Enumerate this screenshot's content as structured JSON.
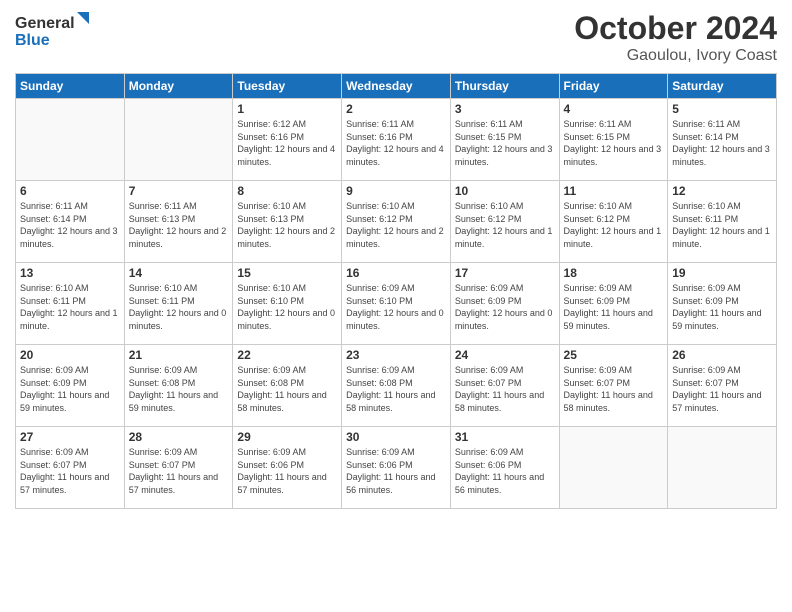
{
  "header": {
    "logo_general": "General",
    "logo_blue": "Blue",
    "month_title": "October 2024",
    "location": "Gaoulou, Ivory Coast"
  },
  "weekdays": [
    "Sunday",
    "Monday",
    "Tuesday",
    "Wednesday",
    "Thursday",
    "Friday",
    "Saturday"
  ],
  "weeks": [
    [
      {
        "day": "",
        "info": ""
      },
      {
        "day": "",
        "info": ""
      },
      {
        "day": "1",
        "info": "Sunrise: 6:12 AM\nSunset: 6:16 PM\nDaylight: 12 hours\nand 4 minutes."
      },
      {
        "day": "2",
        "info": "Sunrise: 6:11 AM\nSunset: 6:16 PM\nDaylight: 12 hours\nand 4 minutes."
      },
      {
        "day": "3",
        "info": "Sunrise: 6:11 AM\nSunset: 6:15 PM\nDaylight: 12 hours\nand 3 minutes."
      },
      {
        "day": "4",
        "info": "Sunrise: 6:11 AM\nSunset: 6:15 PM\nDaylight: 12 hours\nand 3 minutes."
      },
      {
        "day": "5",
        "info": "Sunrise: 6:11 AM\nSunset: 6:14 PM\nDaylight: 12 hours\nand 3 minutes."
      }
    ],
    [
      {
        "day": "6",
        "info": "Sunrise: 6:11 AM\nSunset: 6:14 PM\nDaylight: 12 hours\nand 3 minutes."
      },
      {
        "day": "7",
        "info": "Sunrise: 6:11 AM\nSunset: 6:13 PM\nDaylight: 12 hours\nand 2 minutes."
      },
      {
        "day": "8",
        "info": "Sunrise: 6:10 AM\nSunset: 6:13 PM\nDaylight: 12 hours\nand 2 minutes."
      },
      {
        "day": "9",
        "info": "Sunrise: 6:10 AM\nSunset: 6:12 PM\nDaylight: 12 hours\nand 2 minutes."
      },
      {
        "day": "10",
        "info": "Sunrise: 6:10 AM\nSunset: 6:12 PM\nDaylight: 12 hours\nand 1 minute."
      },
      {
        "day": "11",
        "info": "Sunrise: 6:10 AM\nSunset: 6:12 PM\nDaylight: 12 hours\nand 1 minute."
      },
      {
        "day": "12",
        "info": "Sunrise: 6:10 AM\nSunset: 6:11 PM\nDaylight: 12 hours\nand 1 minute."
      }
    ],
    [
      {
        "day": "13",
        "info": "Sunrise: 6:10 AM\nSunset: 6:11 PM\nDaylight: 12 hours\nand 1 minute."
      },
      {
        "day": "14",
        "info": "Sunrise: 6:10 AM\nSunset: 6:11 PM\nDaylight: 12 hours\nand 0 minutes."
      },
      {
        "day": "15",
        "info": "Sunrise: 6:10 AM\nSunset: 6:10 PM\nDaylight: 12 hours\nand 0 minutes."
      },
      {
        "day": "16",
        "info": "Sunrise: 6:09 AM\nSunset: 6:10 PM\nDaylight: 12 hours\nand 0 minutes."
      },
      {
        "day": "17",
        "info": "Sunrise: 6:09 AM\nSunset: 6:09 PM\nDaylight: 12 hours\nand 0 minutes."
      },
      {
        "day": "18",
        "info": "Sunrise: 6:09 AM\nSunset: 6:09 PM\nDaylight: 11 hours\nand 59 minutes."
      },
      {
        "day": "19",
        "info": "Sunrise: 6:09 AM\nSunset: 6:09 PM\nDaylight: 11 hours\nand 59 minutes."
      }
    ],
    [
      {
        "day": "20",
        "info": "Sunrise: 6:09 AM\nSunset: 6:09 PM\nDaylight: 11 hours\nand 59 minutes."
      },
      {
        "day": "21",
        "info": "Sunrise: 6:09 AM\nSunset: 6:08 PM\nDaylight: 11 hours\nand 59 minutes."
      },
      {
        "day": "22",
        "info": "Sunrise: 6:09 AM\nSunset: 6:08 PM\nDaylight: 11 hours\nand 58 minutes."
      },
      {
        "day": "23",
        "info": "Sunrise: 6:09 AM\nSunset: 6:08 PM\nDaylight: 11 hours\nand 58 minutes."
      },
      {
        "day": "24",
        "info": "Sunrise: 6:09 AM\nSunset: 6:07 PM\nDaylight: 11 hours\nand 58 minutes."
      },
      {
        "day": "25",
        "info": "Sunrise: 6:09 AM\nSunset: 6:07 PM\nDaylight: 11 hours\nand 58 minutes."
      },
      {
        "day": "26",
        "info": "Sunrise: 6:09 AM\nSunset: 6:07 PM\nDaylight: 11 hours\nand 57 minutes."
      }
    ],
    [
      {
        "day": "27",
        "info": "Sunrise: 6:09 AM\nSunset: 6:07 PM\nDaylight: 11 hours\nand 57 minutes."
      },
      {
        "day": "28",
        "info": "Sunrise: 6:09 AM\nSunset: 6:07 PM\nDaylight: 11 hours\nand 57 minutes."
      },
      {
        "day": "29",
        "info": "Sunrise: 6:09 AM\nSunset: 6:06 PM\nDaylight: 11 hours\nand 57 minutes."
      },
      {
        "day": "30",
        "info": "Sunrise: 6:09 AM\nSunset: 6:06 PM\nDaylight: 11 hours\nand 56 minutes."
      },
      {
        "day": "31",
        "info": "Sunrise: 6:09 AM\nSunset: 6:06 PM\nDaylight: 11 hours\nand 56 minutes."
      },
      {
        "day": "",
        "info": ""
      },
      {
        "day": "",
        "info": ""
      }
    ]
  ]
}
